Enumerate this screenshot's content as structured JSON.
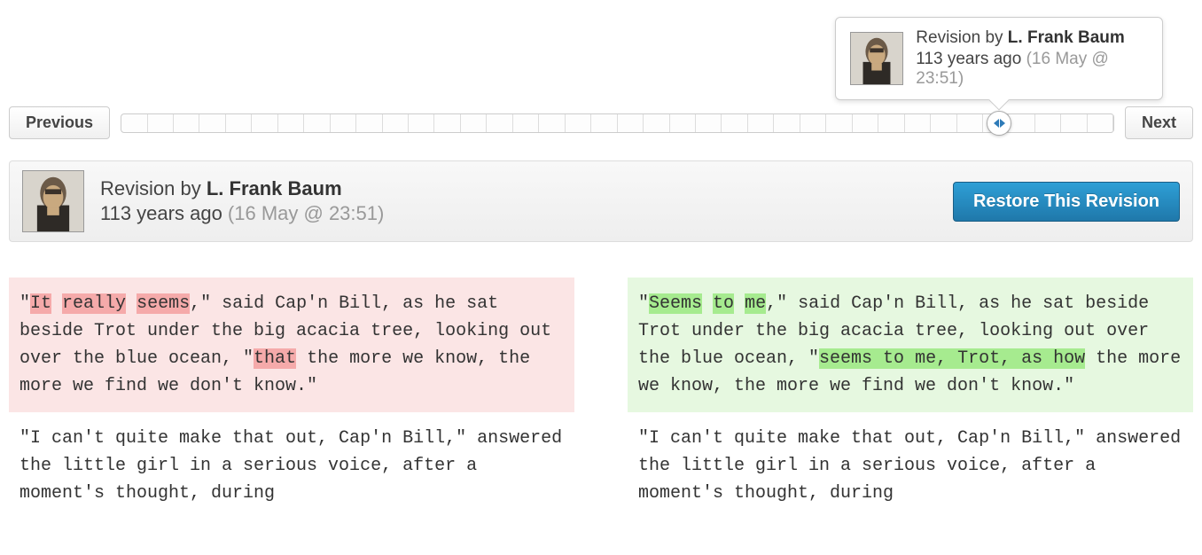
{
  "nav": {
    "prev": "Previous",
    "next": "Next"
  },
  "tooltip": {
    "revision_prefix": "Revision by ",
    "author": "L. Frank Baum",
    "age": "113 years ago ",
    "timestamp": "(16 May @ 23:51)"
  },
  "meta": {
    "revision_prefix": "Revision by ",
    "author": "L. Frank Baum",
    "age": "113 years ago ",
    "timestamp": "(16 May @ 23:51)",
    "restore_label": "Restore This Revision"
  },
  "slider": {
    "tick_count": 38
  },
  "diff": {
    "left": {
      "p1": {
        "t1": "\"",
        "d1": "It",
        "t2": " ",
        "d2": "really",
        "t3": " ",
        "d3": "seems",
        "t4": ",\" said Cap'n Bill, as he sat beside Trot under the big acacia tree, looking out over the blue ocean, \"",
        "d4": "that",
        "t5": " the more we know, the more we find we don't know.\""
      },
      "p2": "\"I can't quite make that out, Cap'n Bill,\" answered the little girl in a serious voice, after a moment's thought, during"
    },
    "right": {
      "p1": {
        "t1": "\"",
        "a1": "Seems",
        "t2": " ",
        "a2": "to",
        "t3": " ",
        "a3": "me",
        "t4": ",\" said Cap'n Bill, as he sat beside Trot under the big acacia tree, looking out over the blue ocean, \"",
        "a4": "seems to me, Trot, as how",
        "t5": " the more we know, the more we find we don't know.\""
      },
      "p2": "\"I can't quite make that out, Cap'n Bill,\" answered the little girl in a serious voice, after a moment's thought, during"
    }
  }
}
